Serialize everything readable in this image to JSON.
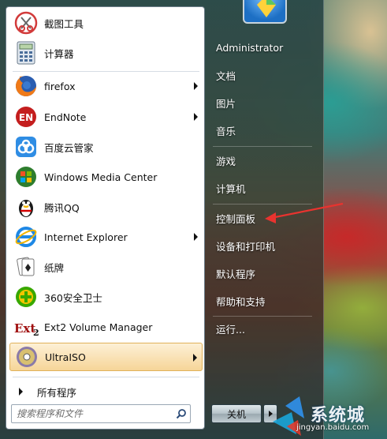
{
  "start_menu": {
    "pinned_programs": [
      {
        "label": "截图工具",
        "icon": "snipping-tool-icon",
        "has_submenu": false
      },
      {
        "label": "计算器",
        "icon": "calculator-icon",
        "has_submenu": false
      }
    ],
    "programs": [
      {
        "label": "firefox",
        "icon": "firefox-icon",
        "has_submenu": true
      },
      {
        "label": "EndNote",
        "icon": "endnote-icon",
        "has_submenu": true
      },
      {
        "label": "百度云管家",
        "icon": "baidu-cloud-icon",
        "has_submenu": false
      },
      {
        "label": "Windows Media Center",
        "icon": "windows-media-center-icon",
        "has_submenu": false
      },
      {
        "label": "腾讯QQ",
        "icon": "qq-penguin-icon",
        "has_submenu": false
      },
      {
        "label": "Internet Explorer",
        "icon": "internet-explorer-icon",
        "has_submenu": true
      },
      {
        "label": "纸牌",
        "icon": "solitaire-icon",
        "has_submenu": false
      },
      {
        "label": "360安全卫士",
        "icon": "360-security-icon",
        "has_submenu": false
      },
      {
        "label": "Ext2 Volume Manager",
        "icon": "ext2-icon",
        "has_submenu": false
      },
      {
        "label": "UltraISO",
        "icon": "ultraiso-disc-icon",
        "has_submenu": true,
        "selected": true
      }
    ],
    "all_programs_label": "所有程序",
    "search": {
      "placeholder": "搜索程序和文件"
    },
    "right_pane": {
      "items": [
        "Administrator",
        "文档",
        "图片",
        "音乐",
        "游戏",
        "计算机",
        "控制面板",
        "设备和打印机",
        "默认程序",
        "帮助和支持",
        "运行..."
      ]
    },
    "shutdown_label": "关机"
  },
  "watermark": {
    "text": "系统城",
    "url": "jingyan.baidu.com"
  },
  "colors": {
    "selected_bg": "#f6d598",
    "annotation_arrow": "#e8332f",
    "left_pane_bg": "#ffffff"
  }
}
